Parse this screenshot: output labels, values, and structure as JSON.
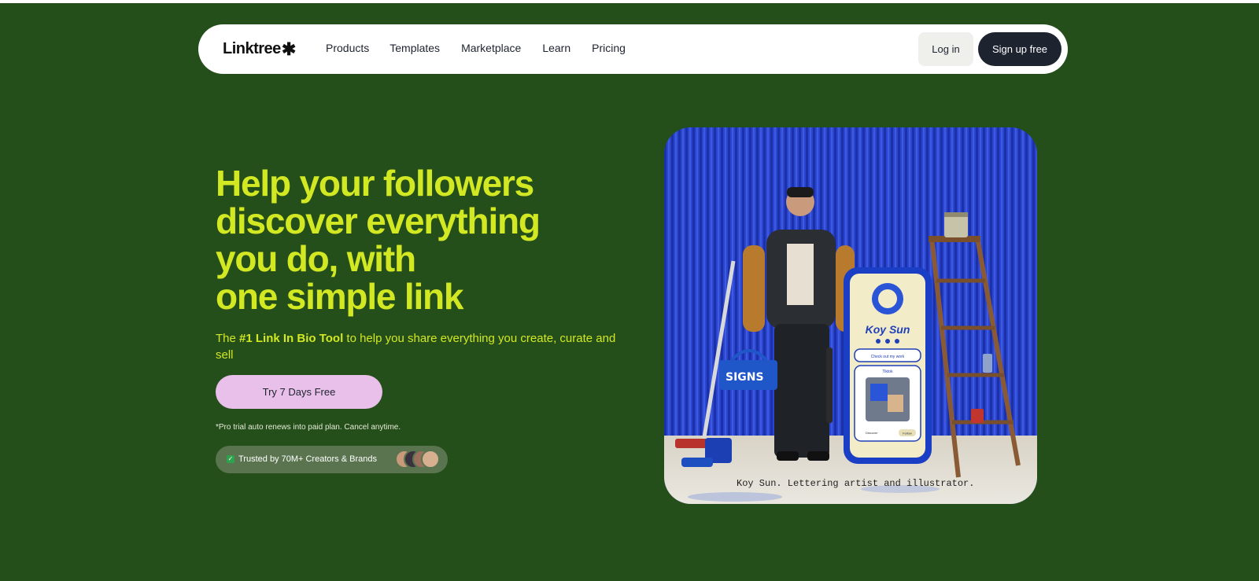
{
  "nav": {
    "logo_text": "Linktree",
    "logo_icon": "asterisk-icon",
    "links": [
      "Products",
      "Templates",
      "Marketplace",
      "Learn",
      "Pricing"
    ],
    "login_label": "Log in",
    "signup_label": "Sign up free"
  },
  "hero": {
    "headline_lines": [
      "Help your followers",
      "discover everything",
      "you do, with",
      "one simple link"
    ],
    "subtitle_prefix": "The ",
    "subtitle_bold": "#1 Link In Bio Tool",
    "subtitle_rest": " to help you share everything you create, curate and sell",
    "cta_label": "Try 7 Days Free",
    "disclaimer": "*Pro trial auto renews into paid plan. Cancel anytime.",
    "trust_text": "Trusted by 70M+ Creators & Brands"
  },
  "feature_image": {
    "caption": "Koy Sun. Lettering artist and illustrator.",
    "phone_name": "Koy Sun",
    "phone_buttons": [
      "Check out my work",
      "Tiktok",
      "Discover",
      "Follow"
    ],
    "box_label": "SIGNS"
  },
  "colors": {
    "background": "#254f1a",
    "accent": "#d2e823",
    "cta": "#e9c0e9",
    "dark": "#1e2330"
  }
}
